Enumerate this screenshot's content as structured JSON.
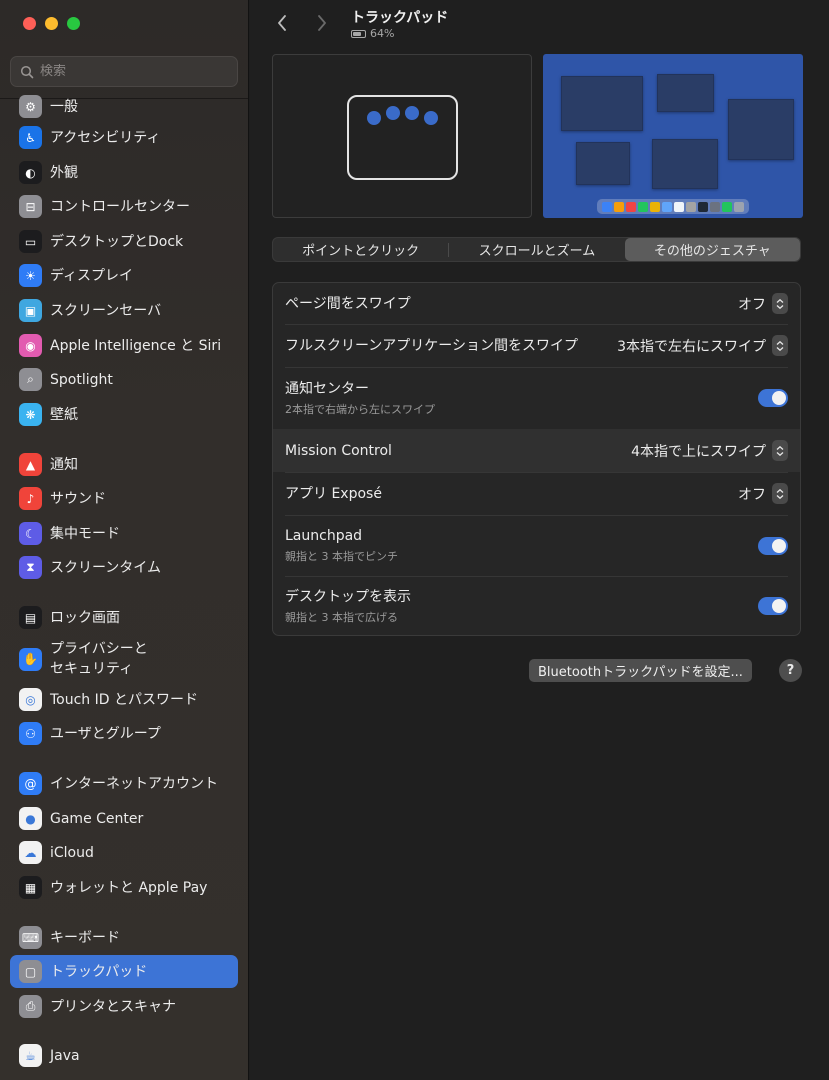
{
  "window": {
    "title": "トラックパッド",
    "battery_label": "64%",
    "battery_level": 0.64
  },
  "search": {
    "placeholder": "検索",
    "value": ""
  },
  "sidebar": {
    "items": [
      {
        "label": "一般",
        "icon": "gear-icon",
        "color": "#8e8e93"
      },
      {
        "label": "アクセシビリティ",
        "icon": "accessibility-icon",
        "color": "#1a73e8"
      },
      {
        "label": "外観",
        "icon": "appearance-icon",
        "color": "#1c1c1e"
      },
      {
        "label": "コントロールセンター",
        "icon": "control-center-icon",
        "color": "#8e8e93"
      },
      {
        "label": "デスクトップとDock",
        "icon": "desktop-dock-icon",
        "color": "#1c1c1e"
      },
      {
        "label": "ディスプレイ",
        "icon": "display-icon",
        "color": "#2f7cf6"
      },
      {
        "label": "スクリーンセーバ",
        "icon": "screensaver-icon",
        "color": "#3fa7e0"
      },
      {
        "label": "Apple Intelligence と Siri",
        "icon": "siri-icon",
        "color": "#e25bb0"
      },
      {
        "label": "Spotlight",
        "icon": "spotlight-icon",
        "color": "#8e8e93"
      },
      {
        "label": "壁紙",
        "icon": "wallpaper-icon",
        "color": "#3ab3f0"
      },
      {
        "label": "通知",
        "icon": "notifications-icon",
        "color": "#f0443a"
      },
      {
        "label": "サウンド",
        "icon": "sound-icon",
        "color": "#f0443a"
      },
      {
        "label": "集中モード",
        "icon": "focus-icon",
        "color": "#5e5ce6"
      },
      {
        "label": "スクリーンタイム",
        "icon": "screen-time-icon",
        "color": "#5e5ce6"
      },
      {
        "label": "ロック画面",
        "icon": "lock-screen-icon",
        "color": "#1c1c1e"
      },
      {
        "label": "プライバシーと\nセキュリティ",
        "icon": "privacy-hand-icon",
        "color": "#2f7cf6"
      },
      {
        "label": "Touch ID とパスワード",
        "icon": "fingerprint-icon",
        "color": "#f2f2f2"
      },
      {
        "label": "ユーザとグループ",
        "icon": "users-icon",
        "color": "#2f7cf6"
      },
      {
        "label": "インターネットアカウント",
        "icon": "at-sign-icon",
        "color": "#2f7cf6"
      },
      {
        "label": "Game Center",
        "icon": "game-center-icon",
        "color": "#f2f2f2"
      },
      {
        "label": "iCloud",
        "icon": "icloud-icon",
        "color": "#f2f2f2"
      },
      {
        "label": "ウォレットと Apple Pay",
        "icon": "wallet-icon",
        "color": "#1c1c1e"
      },
      {
        "label": "キーボード",
        "icon": "keyboard-icon",
        "color": "#8e8e93"
      },
      {
        "label": "トラックパッド",
        "icon": "trackpad-icon",
        "color": "#8e8e93",
        "selected": true
      },
      {
        "label": "プリンタとスキャナ",
        "icon": "printer-icon",
        "color": "#8e8e93"
      },
      {
        "label": "Java",
        "icon": "java-icon",
        "color": "#f2f2f2"
      }
    ]
  },
  "tabs": [
    {
      "label": "ポイントとクリック"
    },
    {
      "label": "スクロールとズーム"
    },
    {
      "label": "その他のジェスチャ",
      "active": true
    }
  ],
  "settings": [
    {
      "name": "ページ間をスワイプ",
      "control": "popup",
      "value": "オフ"
    },
    {
      "name": "フルスクリーンアプリケーション間をスワイプ",
      "control": "popup",
      "value": "3本指で左右にスワイプ"
    },
    {
      "name": "通知センター",
      "sub": "2本指で右端から左にスワイプ",
      "control": "toggle",
      "on": true
    },
    {
      "name": "Mission Control",
      "control": "popup",
      "value": "4本指で上にスワイプ"
    },
    {
      "name": "アプリ Exposé",
      "control": "popup",
      "value": "オフ"
    },
    {
      "name": "Launchpad",
      "sub": "親指と 3 本指でピンチ",
      "control": "toggle",
      "on": true
    },
    {
      "name": "デスクトップを表示",
      "sub": "親指と 3 本指で広げる",
      "control": "toggle",
      "on": true
    }
  ],
  "footer": {
    "bluetooth_button": "Bluetoothトラックパッドを設定...",
    "help": "?"
  },
  "colors": {
    "accent": "#3d74d6",
    "selection": "#3d74d6"
  }
}
